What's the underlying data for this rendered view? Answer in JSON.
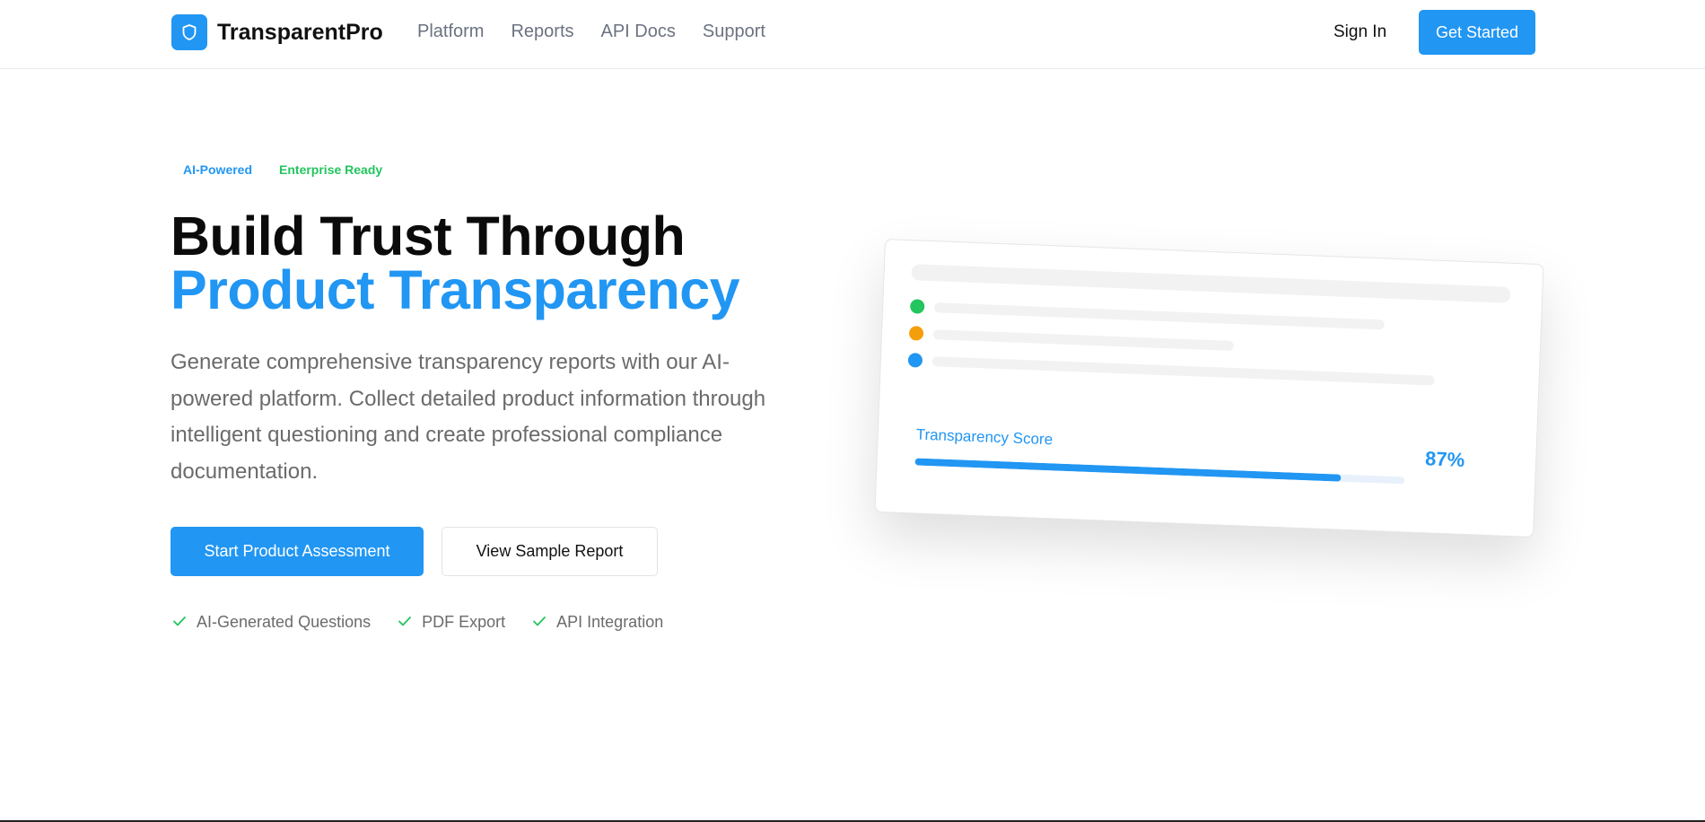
{
  "header": {
    "logo_text": "TransparentPro",
    "nav": [
      "Platform",
      "Reports",
      "API Docs",
      "Support"
    ],
    "sign_in": "Sign In",
    "get_started": "Get Started"
  },
  "hero": {
    "badges": [
      "AI-Powered",
      "Enterprise Ready"
    ],
    "title_line1": "Build Trust Through",
    "title_line2": "Product Transparency",
    "description": "Generate comprehensive transparency reports with our AI-powered platform. Collect detailed product information through intelligent questioning and create professional compliance documentation.",
    "primary_button": "Start Product Assessment",
    "secondary_button": "View Sample Report",
    "features": [
      "AI-Generated Questions",
      "PDF Export",
      "API Integration"
    ]
  },
  "preview": {
    "score_label": "Transparency Score",
    "score_value": "87%",
    "score_fraction": 0.87,
    "status_dots": [
      "green",
      "orange",
      "blue"
    ]
  },
  "colors": {
    "accent": "#2196f3",
    "green": "#22c55e",
    "orange": "#f59e0b",
    "blue": "#2196f3"
  },
  "icons": {
    "logo": "shield-icon",
    "feature": "check-icon"
  }
}
